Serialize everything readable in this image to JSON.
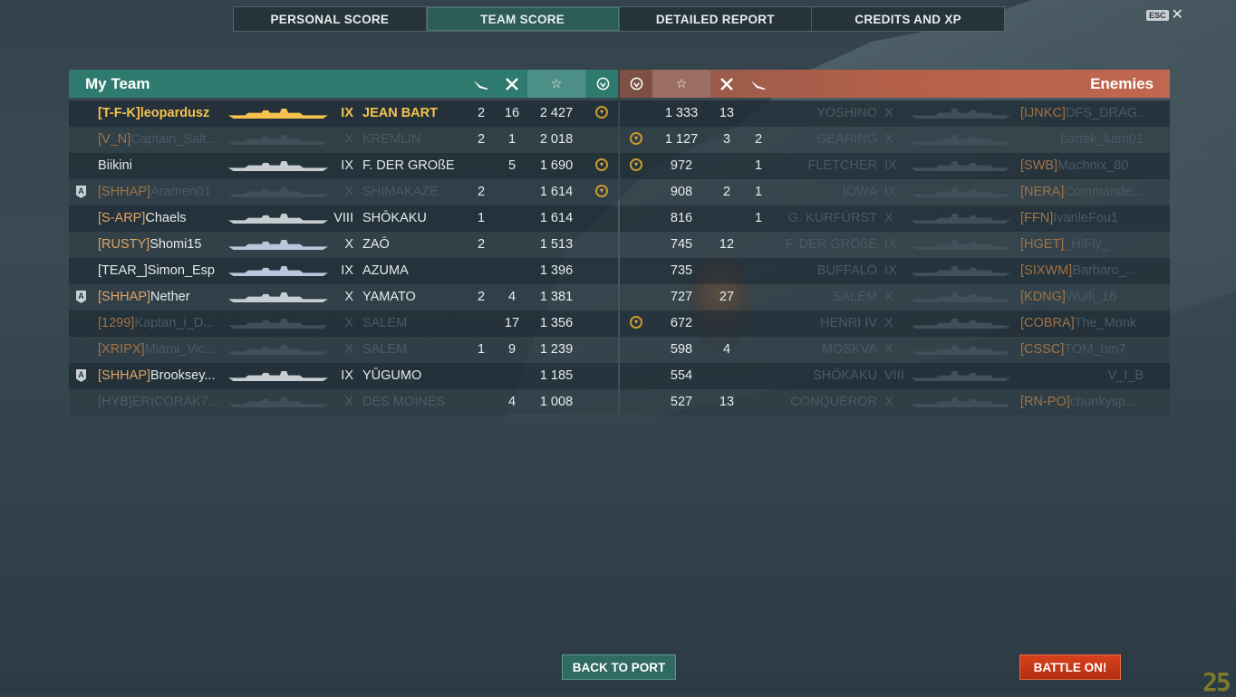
{
  "tabs": [
    "PERSONAL SCORE",
    "TEAM SCORE",
    "DETAILED REPORT",
    "CREDITS AND XP"
  ],
  "active_tab": "TEAM SCORE",
  "esc_label": "ESC",
  "close_glyph": "✕",
  "my_team": {
    "title": "My Team",
    "header_icons": {
      "planes": "plane-icon",
      "kills": "crossed-swords-icon",
      "xp": "star-icon",
      "medal": "medal-icon"
    },
    "rows": [
      {
        "clan": "[T-F-K]",
        "player": "leopardusz",
        "tier": "IX",
        "ship": "JEAN BART",
        "planes": "2",
        "kills": "16",
        "xp": "2 427",
        "medal": true,
        "style": "me",
        "badge": false
      },
      {
        "clan": "[V_N]",
        "player": "Captain_Salt...",
        "tier": "X",
        "ship": "KREMLIN",
        "planes": "2",
        "kills": "1",
        "xp": "2 018",
        "medal": false,
        "style": "dim",
        "badge": false
      },
      {
        "clan": "",
        "player": "Biikini",
        "tier": "IX",
        "ship": "F. DER GROßE",
        "planes": "",
        "kills": "5",
        "xp": "1 690",
        "medal": true,
        "style": "normal",
        "badge": false
      },
      {
        "clan": "[SHHAP]",
        "player": "Aramen01",
        "tier": "X",
        "ship": "SHIMAKAZE",
        "planes": "2",
        "kills": "",
        "xp": "1 614",
        "medal": true,
        "style": "dim",
        "badge": true
      },
      {
        "clan": "[S-ARP]",
        "player": "Chaels",
        "tier": "VIII",
        "ship": "SHŌKAKU",
        "planes": "1",
        "kills": "",
        "xp": "1 614",
        "medal": false,
        "style": "normal",
        "badge": false
      },
      {
        "clan": "[RUSTY]",
        "player": "Shomi15",
        "tier": "X",
        "ship": "ZAŌ",
        "planes": "2",
        "kills": "",
        "xp": "1 513",
        "medal": false,
        "style": "normal",
        "badge": false
      },
      {
        "clan": "",
        "player": "[TEAR_]Simon_Esp",
        "tier": "IX",
        "ship": "AZUMA",
        "planes": "",
        "kills": "",
        "xp": "1 396",
        "medal": false,
        "style": "normal",
        "badge": false
      },
      {
        "clan": "[SHHAP]",
        "player": "Nether",
        "tier": "X",
        "ship": "YAMATO",
        "planes": "2",
        "kills": "4",
        "xp": "1 381",
        "medal": false,
        "style": "normal",
        "badge": true
      },
      {
        "clan": "[1299]",
        "player": "Kaptan_i_D...",
        "tier": "X",
        "ship": "SALEM",
        "planes": "",
        "kills": "17",
        "xp": "1 356",
        "medal": false,
        "style": "dim",
        "badge": false
      },
      {
        "clan": "[XRIPX]",
        "player": "Miami_Vic...",
        "tier": "X",
        "ship": "SALEM",
        "planes": "1",
        "kills": "9",
        "xp": "1 239",
        "medal": false,
        "style": "dim",
        "badge": false
      },
      {
        "clan": "[SHHAP]",
        "player": "Brooksey...",
        "tier": "IX",
        "ship": "YŪGUMO",
        "planes": "",
        "kills": "",
        "xp": "1 185",
        "medal": false,
        "style": "normal",
        "badge": true
      },
      {
        "clan": "",
        "player": "[HYB]",
        "player2": "ERICORAK7...",
        "tier": "X",
        "ship": "DES MOINES",
        "planes": "",
        "kills": "4",
        "xp": "1 008",
        "medal": false,
        "style": "dim2",
        "badge": false
      }
    ]
  },
  "enemies": {
    "title": "Enemies",
    "rows": [
      {
        "medal": false,
        "xp": "1 333",
        "kills": "13",
        "planes": "",
        "ship": "YOSHINO",
        "tier": "X",
        "clan": "[IJNKC]",
        "player": "DFS_DRAG...",
        "style": "dim"
      },
      {
        "medal": true,
        "xp": "1 127",
        "kills": "3",
        "planes": "2",
        "ship": "GEARING",
        "tier": "X",
        "clan": "",
        "player": "bartek_kam01",
        "style": "dim"
      },
      {
        "medal": true,
        "xp": "972",
        "kills": "",
        "planes": "1",
        "ship": "FLETCHER",
        "tier": "IX",
        "clan": "[SWB]",
        "player": "Machnix_80",
        "style": "dim"
      },
      {
        "medal": false,
        "xp": "908",
        "kills": "2",
        "planes": "1",
        "ship": "IOWA",
        "tier": "IX",
        "clan": "[NERA]",
        "player": "Commande...",
        "style": "dim"
      },
      {
        "medal": false,
        "xp": "816",
        "kills": "",
        "planes": "1",
        "ship": "G. KURFÜRST",
        "tier": "X",
        "clan": "[FFN]",
        "player": "IvanleFou1",
        "style": "dim"
      },
      {
        "medal": false,
        "xp": "745",
        "kills": "12",
        "planes": "",
        "ship": "F. DER GROßE",
        "tier": "IX",
        "clan": "[HGET]",
        "player": "_HiFly_",
        "style": "dim"
      },
      {
        "medal": false,
        "xp": "735",
        "kills": "",
        "planes": "",
        "ship": "BUFFALO",
        "tier": "IX",
        "clan": "[SIXWM]",
        "player": "Barbaro_...",
        "style": "dim"
      },
      {
        "medal": false,
        "xp": "727",
        "kills": "27",
        "planes": "",
        "ship": "SALEM",
        "tier": "X",
        "clan": "[KDNG]",
        "player": "Wulfi_18",
        "style": "dim"
      },
      {
        "medal": true,
        "xp": "672",
        "kills": "",
        "planes": "",
        "ship": "HENRI IV",
        "tier": "X",
        "clan": "[COBRA]",
        "player": "The_Monk",
        "style": "dim"
      },
      {
        "medal": false,
        "xp": "598",
        "kills": "4",
        "planes": "",
        "ship": "MOSKVA",
        "tier": "X",
        "clan": "[CSSC]",
        "player": "TOM_hm7",
        "style": "dim"
      },
      {
        "medal": false,
        "xp": "554",
        "kills": "",
        "planes": "",
        "ship": "SHŌKAKU",
        "tier": "VIII",
        "clan": "",
        "player": "V_I_B",
        "style": "dim"
      },
      {
        "medal": false,
        "xp": "527",
        "kills": "13",
        "planes": "",
        "ship": "CONQUEROR",
        "tier": "X",
        "clan": "[RN-PO]",
        "player": "chunkysp...",
        "style": "dim"
      }
    ]
  },
  "buttons": {
    "back": "BACK TO PORT",
    "battle": "BATTLE ON!"
  },
  "fps": "25",
  "colors": {
    "ally_header": "#2f7a6e",
    "enemy_header": "#b4604a",
    "player_highlight": "#f4c24d",
    "clan_tag": "#e0a465",
    "battle_button": "#c8371a"
  }
}
